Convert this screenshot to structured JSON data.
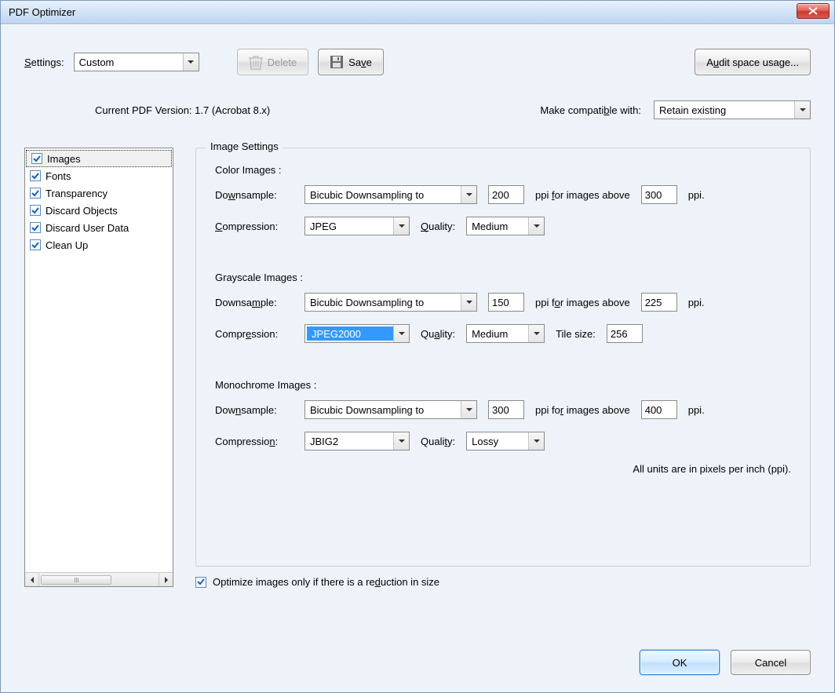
{
  "window": {
    "title": "PDF Optimizer"
  },
  "toolbar": {
    "settings_label": "Settings:",
    "settings_value": "Custom",
    "delete_label": "Delete",
    "save_label": "Save",
    "audit_label": "Audit space usage..."
  },
  "info": {
    "current_version_label": "Current PDF Version: 1.7 (Acrobat 8.x)",
    "compat_label": "Make compatible with:",
    "compat_value": "Retain existing"
  },
  "sidebar": {
    "items": [
      {
        "label": "Images",
        "checked": true,
        "selected": true
      },
      {
        "label": "Fonts",
        "checked": true,
        "selected": false
      },
      {
        "label": "Transparency",
        "checked": true,
        "selected": false
      },
      {
        "label": "Discard Objects",
        "checked": true,
        "selected": false
      },
      {
        "label": "Discard User Data",
        "checked": true,
        "selected": false
      },
      {
        "label": "Clean Up",
        "checked": true,
        "selected": false
      }
    ]
  },
  "panel": {
    "title": "Image Settings",
    "color": {
      "heading": "Color Images :",
      "downsample_label": "Downsample:",
      "downsample_value": "Bicubic Downsampling to",
      "ppi_value": "200",
      "for_images_label": "ppi for images above",
      "above_value": "300",
      "ppi_suffix": "ppi.",
      "compression_label": "Compression:",
      "compression_value": "JPEG",
      "quality_label": "Quality:",
      "quality_value": "Medium"
    },
    "gray": {
      "heading": "Grayscale Images :",
      "downsample_label": "Downsample:",
      "downsample_value": "Bicubic Downsampling to",
      "ppi_value": "150",
      "for_images_label": "ppi for images above",
      "above_value": "225",
      "ppi_suffix": "ppi.",
      "compression_label": "Compression:",
      "compression_value": "JPEG2000",
      "quality_label": "Quality:",
      "quality_value": "Medium",
      "tilesize_label": "Tile size:",
      "tilesize_value": "256"
    },
    "mono": {
      "heading": "Monochrome Images :",
      "downsample_label": "Downsample:",
      "downsample_value": "Bicubic Downsampling to",
      "ppi_value": "300",
      "for_images_label": "ppi for images above",
      "above_value": "400",
      "ppi_suffix": "ppi.",
      "compression_label": "Compression:",
      "compression_value": "JBIG2",
      "quality_label": "Quality:",
      "quality_value": "Lossy"
    },
    "units_note": "All units are in pixels per inch (ppi).",
    "optimize_only_label": "Optimize images only if there is a reduction in size",
    "optimize_only_checked": true
  },
  "footer": {
    "ok": "OK",
    "cancel": "Cancel"
  }
}
